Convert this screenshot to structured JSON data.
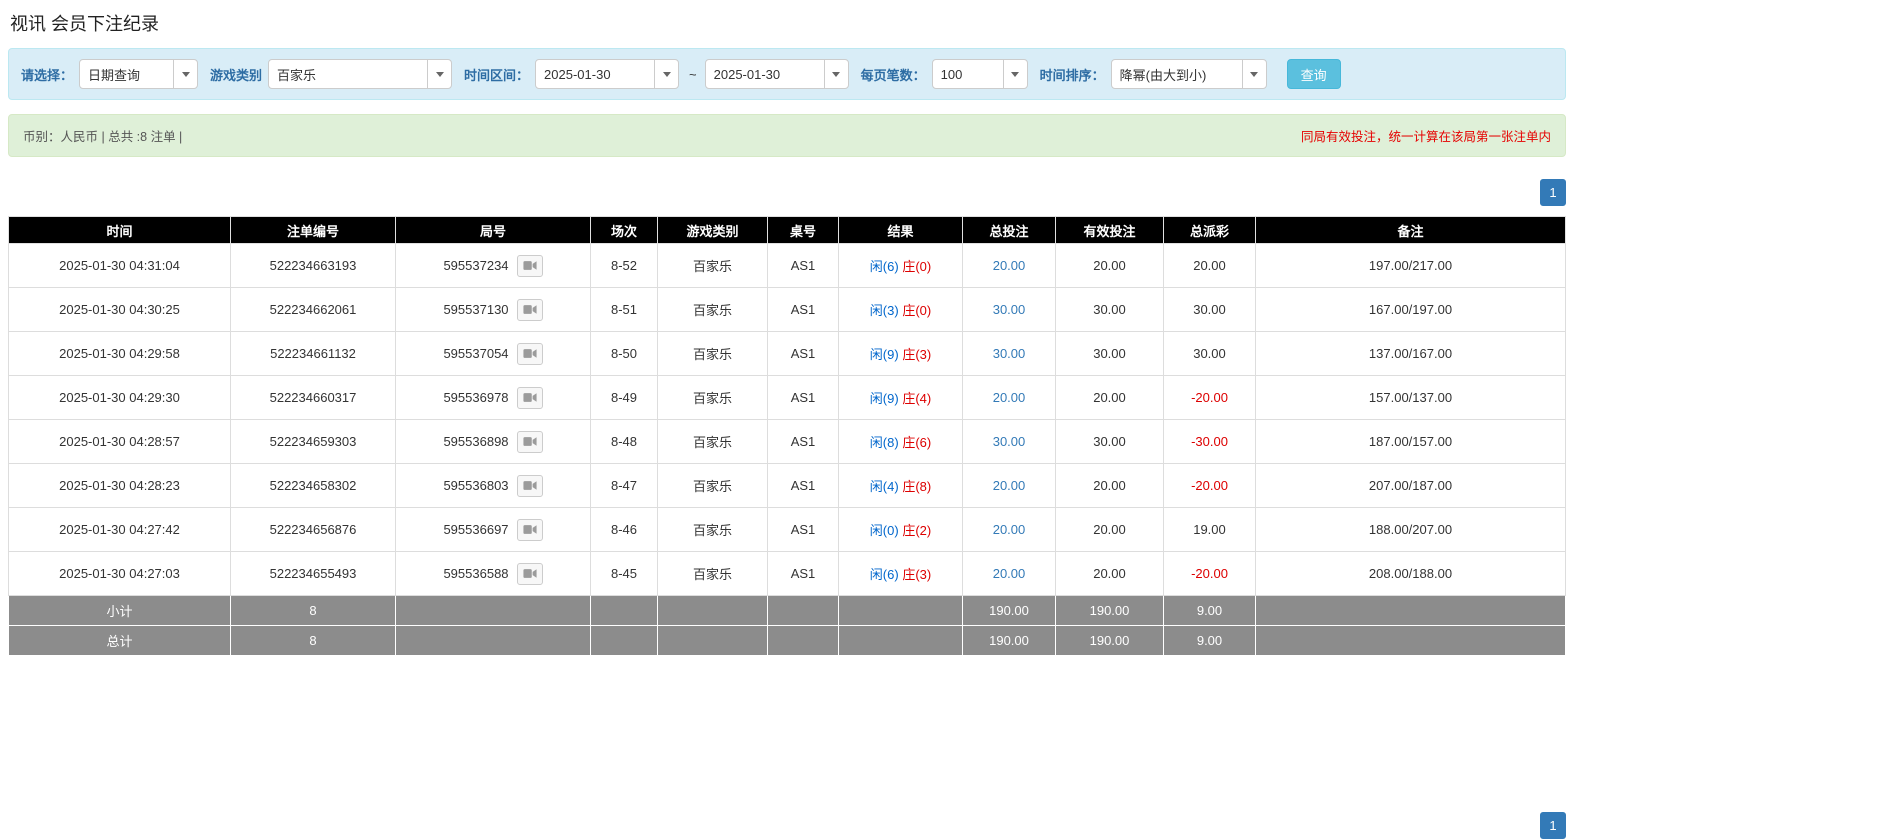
{
  "colors": {
    "accent_blue": "#337ab7",
    "link_blue": "#337ab7",
    "query_button_bg": "#5bc0de",
    "query_button_border": "#46b8da",
    "filter_bg": "#d9edf7",
    "filter_border": "#bce8f1",
    "filter_label": "#2e6da4",
    "summary_bg": "#dff0d8",
    "summary_border": "#d6e9c6",
    "summary_text": "#555555",
    "notice_red": "#e60000",
    "player_blue": "#0066cc",
    "banker_red": "#dd0000",
    "negative_red": "#dd0000",
    "header_bg": "#000000",
    "footer_bg": "#8c8c8c"
  },
  "page": {
    "title": "视讯 会员下注纪录"
  },
  "filters": {
    "select_label": "请选择：",
    "select_value": "日期查询",
    "game_type_label": "游戏类别",
    "game_type_value": "百家乐",
    "time_range_label": "时间区间：",
    "date_from": "2025-01-30",
    "date_separator": "~",
    "date_to": "2025-01-30",
    "page_size_label": "每页笔数：",
    "page_size_value": "100",
    "sort_label": "时间排序：",
    "sort_value": "降幂(由大到小)",
    "query_button": "查询"
  },
  "summary": {
    "currency_info": "币别：人民币 | 总共 :8 注单 |",
    "notice": "同局有效投注，统一计算在该局第一张注单内"
  },
  "pagination": {
    "page": "1"
  },
  "table": {
    "headers": [
      "时间",
      "注单编号",
      "局号",
      "场次",
      "游戏类别",
      "桌号",
      "结果",
      "总投注",
      "有效投注",
      "总派彩",
      "备注"
    ],
    "rows": [
      {
        "time": "2025-01-30 04:31:04",
        "bet_id": "522234663193",
        "round_id": "595537234",
        "session": "8-52",
        "game": "百家乐",
        "table_no": "AS1",
        "result_player": "闲(6)",
        "result_banker": "庄(0)",
        "total_bet": "20.00",
        "valid_bet": "20.00",
        "payout": "20.00",
        "remark": "197.00/217.00"
      },
      {
        "time": "2025-01-30 04:30:25",
        "bet_id": "522234662061",
        "round_id": "595537130",
        "session": "8-51",
        "game": "百家乐",
        "table_no": "AS1",
        "result_player": "闲(3)",
        "result_banker": "庄(0)",
        "total_bet": "30.00",
        "valid_bet": "30.00",
        "payout": "30.00",
        "remark": "167.00/197.00"
      },
      {
        "time": "2025-01-30 04:29:58",
        "bet_id": "522234661132",
        "round_id": "595537054",
        "session": "8-50",
        "game": "百家乐",
        "table_no": "AS1",
        "result_player": "闲(9)",
        "result_banker": "庄(3)",
        "total_bet": "30.00",
        "valid_bet": "30.00",
        "payout": "30.00",
        "remark": "137.00/167.00"
      },
      {
        "time": "2025-01-30 04:29:30",
        "bet_id": "522234660317",
        "round_id": "595536978",
        "session": "8-49",
        "game": "百家乐",
        "table_no": "AS1",
        "result_player": "闲(9)",
        "result_banker": "庄(4)",
        "total_bet": "20.00",
        "valid_bet": "20.00",
        "payout": "-20.00",
        "remark": "157.00/137.00"
      },
      {
        "time": "2025-01-30 04:28:57",
        "bet_id": "522234659303",
        "round_id": "595536898",
        "session": "8-48",
        "game": "百家乐",
        "table_no": "AS1",
        "result_player": "闲(8)",
        "result_banker": "庄(6)",
        "total_bet": "30.00",
        "valid_bet": "30.00",
        "payout": "-30.00",
        "remark": "187.00/157.00"
      },
      {
        "time": "2025-01-30 04:28:23",
        "bet_id": "522234658302",
        "round_id": "595536803",
        "session": "8-47",
        "game": "百家乐",
        "table_no": "AS1",
        "result_player": "闲(4)",
        "result_banker": "庄(8)",
        "total_bet": "20.00",
        "valid_bet": "20.00",
        "payout": "-20.00",
        "remark": "207.00/187.00"
      },
      {
        "time": "2025-01-30 04:27:42",
        "bet_id": "522234656876",
        "round_id": "595536697",
        "session": "8-46",
        "game": "百家乐",
        "table_no": "AS1",
        "result_player": "闲(0)",
        "result_banker": "庄(2)",
        "total_bet": "20.00",
        "valid_bet": "20.00",
        "payout": "19.00",
        "remark": "188.00/207.00"
      },
      {
        "time": "2025-01-30 04:27:03",
        "bet_id": "522234655493",
        "round_id": "595536588",
        "session": "8-45",
        "game": "百家乐",
        "table_no": "AS1",
        "result_player": "闲(6)",
        "result_banker": "庄(3)",
        "total_bet": "20.00",
        "valid_bet": "20.00",
        "payout": "-20.00",
        "remark": "208.00/188.00"
      }
    ],
    "footer_rows": [
      {
        "label": "小计",
        "count": "8",
        "total_bet": "190.00",
        "valid_bet": "190.00",
        "payout": "9.00"
      },
      {
        "label": "总计",
        "count": "8",
        "total_bet": "190.00",
        "valid_bet": "190.00",
        "payout": "9.00"
      }
    ]
  }
}
